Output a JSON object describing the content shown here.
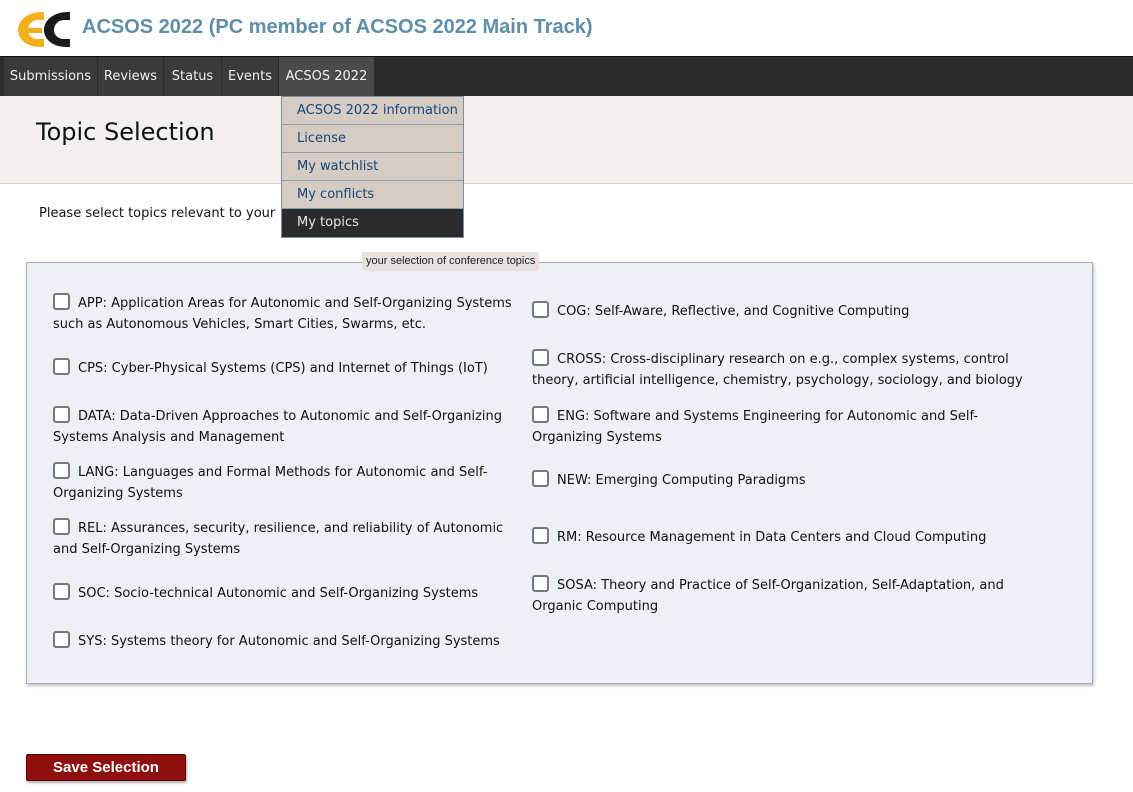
{
  "header": {
    "logo_icon": "easychair-logo-icon",
    "title": "ACSOS 2022 (PC member of ACSOS 2022 Main Track)",
    "title_color": "#5f8fa7"
  },
  "menu": {
    "items": [
      {
        "label": "Submissions"
      },
      {
        "label": "Reviews"
      },
      {
        "label": "Status"
      },
      {
        "label": "Events"
      },
      {
        "label": "ACSOS 2022"
      }
    ],
    "dropdown": [
      {
        "label": "ACSOS 2022 information"
      },
      {
        "label": "License"
      },
      {
        "label": "My watchlist"
      },
      {
        "label": "My conflicts"
      },
      {
        "label": "My topics",
        "selected": true
      }
    ]
  },
  "page": {
    "title": "Topic Selection",
    "intro": "Please select topics relevant to your"
  },
  "topics": {
    "legend": "your selection of conference topics",
    "left": [
      {
        "label": "APP: Application Areas for Autonomic and Self-Organizing Systems such as Autonomous Vehicles, Smart Cities, Swarms, etc.",
        "checked": false
      },
      {
        "label": "CPS: Cyber-Physical Systems (CPS) and Internet of Things (IoT)",
        "checked": false
      },
      {
        "label": "DATA: Data-Driven Approaches to Autonomic and Self-Organizing Systems Analysis and Management",
        "checked": false
      },
      {
        "label": "LANG: Languages and Formal Methods for Autonomic and Self-Organizing Systems",
        "checked": false
      },
      {
        "label": "REL: Assurances, security, resilience, and reliability of Autonomic and Self-Organizing Systems",
        "checked": false
      },
      {
        "label": "SOC: Socio-technical Autonomic and Self-Organizing Systems",
        "checked": false
      },
      {
        "label": "SYS: Systems theory for Autonomic and Self-Organizing Systems",
        "checked": false
      }
    ],
    "right": [
      {
        "label": "COG: Self-Aware, Reflective, and Cognitive Computing",
        "checked": false
      },
      {
        "label": "CROSS: Cross-disciplinary research on e.g., complex systems, control theory, artificial intelligence, chemistry, psychology, sociology, and biology",
        "checked": false
      },
      {
        "label": "ENG: Software and Systems Engineering for Autonomic and Self-Organizing Systems",
        "checked": false
      },
      {
        "label": "NEW: Emerging Computing Paradigms",
        "checked": false
      },
      {
        "label": "RM: Resource Management in Data Centers and Cloud Computing",
        "checked": false
      },
      {
        "label": "SOSA: Theory and Practice of Self-Organization, Self-Adaptation, and Organic Computing",
        "checked": false
      }
    ]
  },
  "actions": {
    "save_label": "Save Selection",
    "save_color": "#8f0f0f"
  }
}
